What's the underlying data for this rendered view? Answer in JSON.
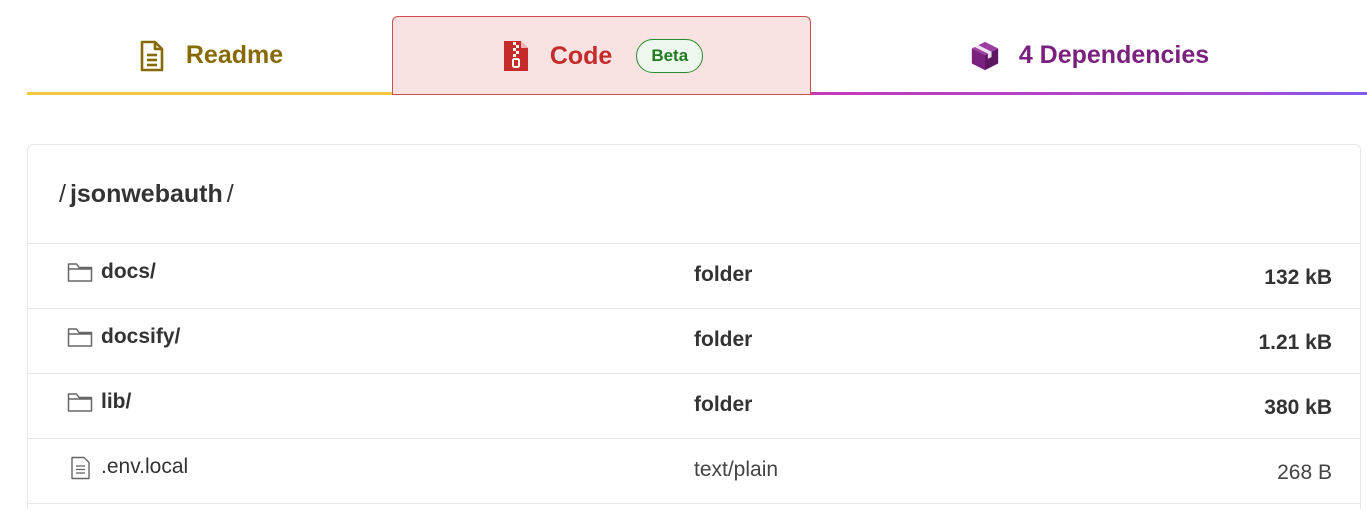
{
  "tabs": {
    "readme": {
      "label": "Readme",
      "icon": "document-icon"
    },
    "code": {
      "label": "Code",
      "badge": "Beta",
      "icon": "zip-file-icon"
    },
    "dependencies": {
      "label": "4 Dependencies",
      "icon": "package-box-icon"
    }
  },
  "colors": {
    "readme": "#866a04",
    "code": "#c62b2b",
    "dependencies": "#7a2180",
    "badge": "#1f7a1f"
  },
  "breadcrumb": {
    "root_sep": "/",
    "folder": "jsonwebauth",
    "trail_sep": "/"
  },
  "files": [
    {
      "name": "docs/",
      "type": "folder",
      "size": "132 kB",
      "icon": "folder-icon"
    },
    {
      "name": "docsify/",
      "type": "folder",
      "size": "1.21 kB",
      "icon": "folder-icon"
    },
    {
      "name": "lib/",
      "type": "folder",
      "size": "380 kB",
      "icon": "folder-icon"
    },
    {
      "name": ".env.local",
      "type": "text/plain",
      "size": "268 B",
      "icon": "file-icon"
    }
  ]
}
